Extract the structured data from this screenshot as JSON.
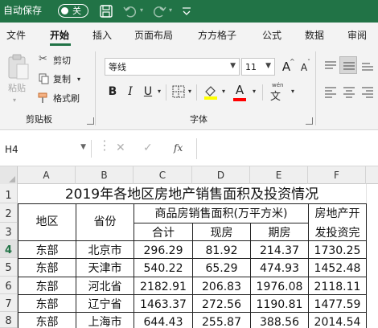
{
  "titlebar": {
    "autosave_label": "自动保存",
    "autosave_state": "关",
    "icons": [
      "save-icon",
      "undo-icon",
      "redo-icon"
    ],
    "accent_color": "#217346"
  },
  "tabs": [
    {
      "label": "文件",
      "active": false
    },
    {
      "label": "开始",
      "active": true
    },
    {
      "label": "插入",
      "active": false
    },
    {
      "label": "页面布局",
      "active": false
    },
    {
      "label": "方方格子",
      "active": false
    },
    {
      "label": "公式",
      "active": false
    },
    {
      "label": "数据",
      "active": false
    },
    {
      "label": "审阅",
      "active": false
    }
  ],
  "ribbon": {
    "clipboard": {
      "paste_label": "粘贴",
      "cut_label": "剪切",
      "copy_label": "复制",
      "format_painter_label": "格式刷",
      "group_label": "剪贴板"
    },
    "font": {
      "font_name": "等线",
      "font_size": "11",
      "bold_label": "B",
      "italic_label": "I",
      "underline_label": "U",
      "increase_size_label": "A",
      "decrease_size_label": "A",
      "font_color_label": "A",
      "highlight_color": "#ffff00",
      "font_color": "#ff0000",
      "phonetic_label": "wén",
      "group_label": "字体"
    }
  },
  "formula_bar": {
    "cell_reference": "H4",
    "fx_label": "fx",
    "formula": ""
  },
  "sheet": {
    "columns": [
      "A",
      "B",
      "C",
      "D",
      "E",
      "F"
    ],
    "rows": [
      "1",
      "2",
      "3",
      "4",
      "5",
      "6",
      "7",
      "8"
    ],
    "selected_row": "4",
    "title": "2019年各地区房地产销售面积及投资情况",
    "header": {
      "region": "地区",
      "province": "省份",
      "sales_area": "商品房销售面积(万平方米)",
      "total": "合计",
      "spot": "现房",
      "futures": "期房",
      "investment_line1": "房地产开",
      "investment_line2": "发投资完"
    },
    "data_rows": [
      {
        "region": "东部",
        "province": "北京市",
        "total": "296.29",
        "spot": "81.92",
        "futures": "214.37",
        "investment": "1730.25"
      },
      {
        "region": "东部",
        "province": "天津市",
        "total": "540.22",
        "spot": "65.29",
        "futures": "474.93",
        "investment": "1452.48"
      },
      {
        "region": "东部",
        "province": "河北省",
        "total": "2182.91",
        "spot": "206.83",
        "futures": "1976.08",
        "investment": "2118.11"
      },
      {
        "region": "东部",
        "province": "辽宁省",
        "total": "1463.37",
        "spot": "272.56",
        "futures": "1190.81",
        "investment": "1477.59"
      },
      {
        "region": "东部",
        "province": "上海市",
        "total": "644.43",
        "spot": "255.87",
        "futures": "388.56",
        "investment": "2014.54"
      }
    ]
  }
}
